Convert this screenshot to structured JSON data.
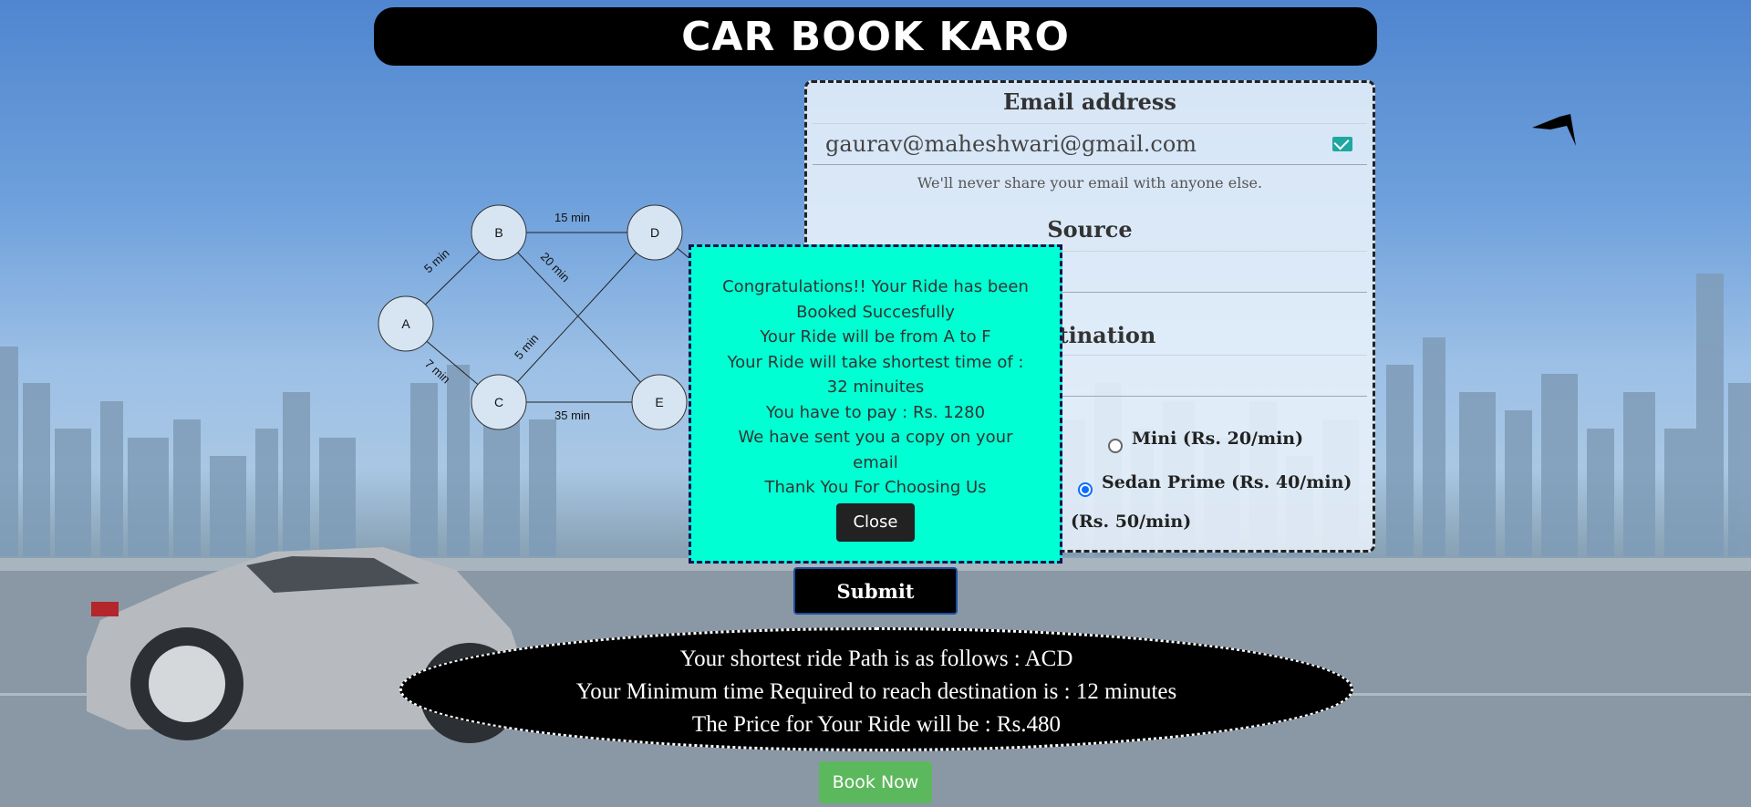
{
  "header": {
    "title": "CAR BOOK KARO"
  },
  "form": {
    "email_label": "Email address",
    "email_value": "gaurav@maheshwari@gmail.com",
    "email_help": "We'll never share your email with anyone else.",
    "source_label": "Source",
    "destination_label_visible": "stination",
    "radios": [
      {
        "label_visible": ")",
        "checked": false
      },
      {
        "label": "Mini (Rs. 20/min)",
        "checked": false
      },
      {
        "label": "Sedan Prime (Rs. 40/min)",
        "checked": true
      },
      {
        "label_visible": "(Rs. 50/min)",
        "checked": false
      }
    ]
  },
  "graph": {
    "nodes": [
      "A",
      "B",
      "C",
      "D",
      "E"
    ],
    "edges": [
      {
        "from": "A",
        "to": "B",
        "label": "5 min"
      },
      {
        "from": "A",
        "to": "C",
        "label": "7 min"
      },
      {
        "from": "B",
        "to": "D",
        "label": "15 min"
      },
      {
        "from": "B",
        "to": "E",
        "label": "20 min"
      },
      {
        "from": "C",
        "to": "D",
        "label": "5 min"
      },
      {
        "from": "C",
        "to": "E",
        "label": "35 min"
      }
    ]
  },
  "modal": {
    "lines": [
      "Congratulations!! Your Ride has been",
      "Booked Succesfully",
      "Your Ride will be from A to F",
      "Your Ride will take shortest time of :",
      "32 minuites",
      "You have to pay : Rs. 1280",
      "We have sent you a copy on your",
      "email",
      "Thank You For Choosing Us"
    ],
    "close_label": "Close"
  },
  "submit_label": "Submit",
  "result": {
    "line1": "Your shortest ride Path is as follows : ACD",
    "line2": "Your Minimum time Required to reach destination is : 12 minutes",
    "line3": "The Price for Your Ride will be : Rs.480"
  },
  "book_now_label": "Book Now",
  "colors": {
    "modal_bg": "#00ffd2",
    "book_button": "#5cb85c",
    "header_bg": "#000000"
  }
}
